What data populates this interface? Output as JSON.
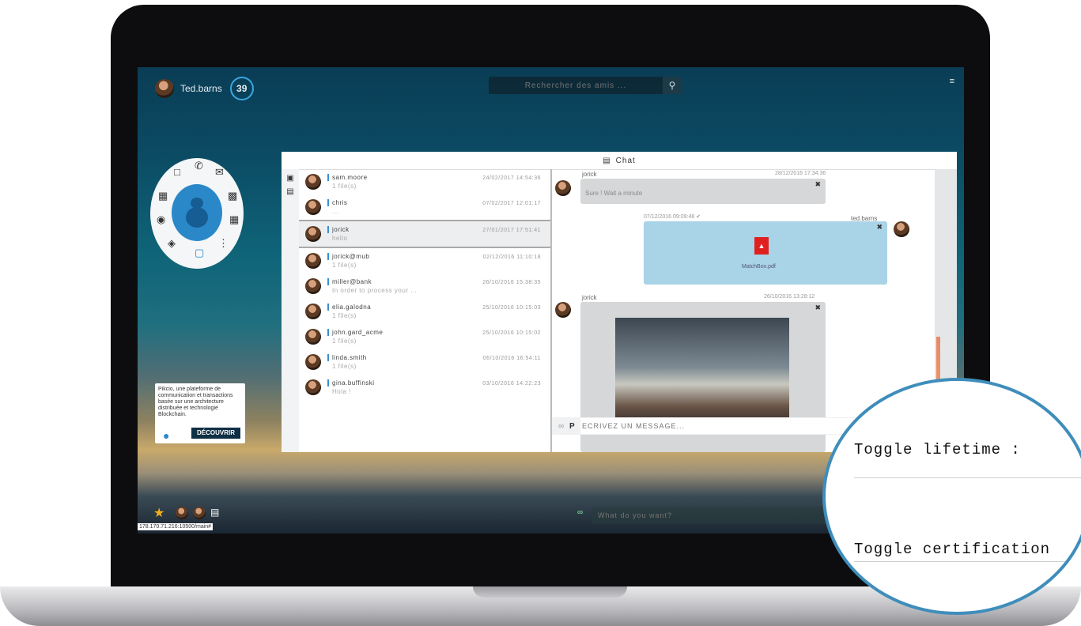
{
  "user": {
    "name": "Ted.barns",
    "badge": "39"
  },
  "search": {
    "placeholder": "Rechercher des amis ..."
  },
  "menu_icon": "menu-icon",
  "promo": {
    "text": "Pikcio, une plateforme de communication et transactions basée sur une architecture distribuée et technologie Blockchain.",
    "button": "DÉCOUVRIR"
  },
  "chat": {
    "title": "Chat",
    "contacts": [
      {
        "name": "sam.moore",
        "sub": "1 file(s)",
        "date": "24/02/2017 14:54:36"
      },
      {
        "name": "chris",
        "sub": "...",
        "date": "07/02/2017 12:01:17"
      },
      {
        "name": "jorick",
        "sub": "hello",
        "date": "27/01/2017 17:51:41"
      },
      {
        "name": "jorick@mub",
        "sub": "1 file(s)",
        "date": "02/12/2016 11:10:18"
      },
      {
        "name": "miller@bank",
        "sub": "In order to process your ...",
        "date": "26/10/2016 15:38:35"
      },
      {
        "name": "elia.galodna",
        "sub": "1 file(s)",
        "date": "25/10/2016 10:15:03"
      },
      {
        "name": "john.gard_acme",
        "sub": "1 file(s)",
        "date": "25/10/2016 10:15:02"
      },
      {
        "name": "linda.smith",
        "sub": "1 file(s)",
        "date": "06/10/2016 16:54:11"
      },
      {
        "name": "gina.buffinski",
        "sub": "Hola !",
        "date": "03/10/2016 14:22:23"
      }
    ],
    "messages": [
      {
        "user": "jorick",
        "date": "28/12/2016 17:34:36",
        "text": "Sure ! Wait a minute"
      },
      {
        "user": "ted.barns",
        "date": "07/12/2016 09:09:48 ✔",
        "file": "MatchBox.pdf"
      },
      {
        "user": "jorick",
        "date": "26/10/2016 13:28:12",
        "image": "photo"
      }
    ],
    "composer_placeholder": "ECRIVEZ UN MESSAGE..."
  },
  "bottom": {
    "url": "178.170.71.216:10500/main#",
    "ask_placeholder": "What do you want?"
  },
  "magnifier": {
    "label1": "Toggle lifetime :",
    "label2": "Toggle certification"
  }
}
